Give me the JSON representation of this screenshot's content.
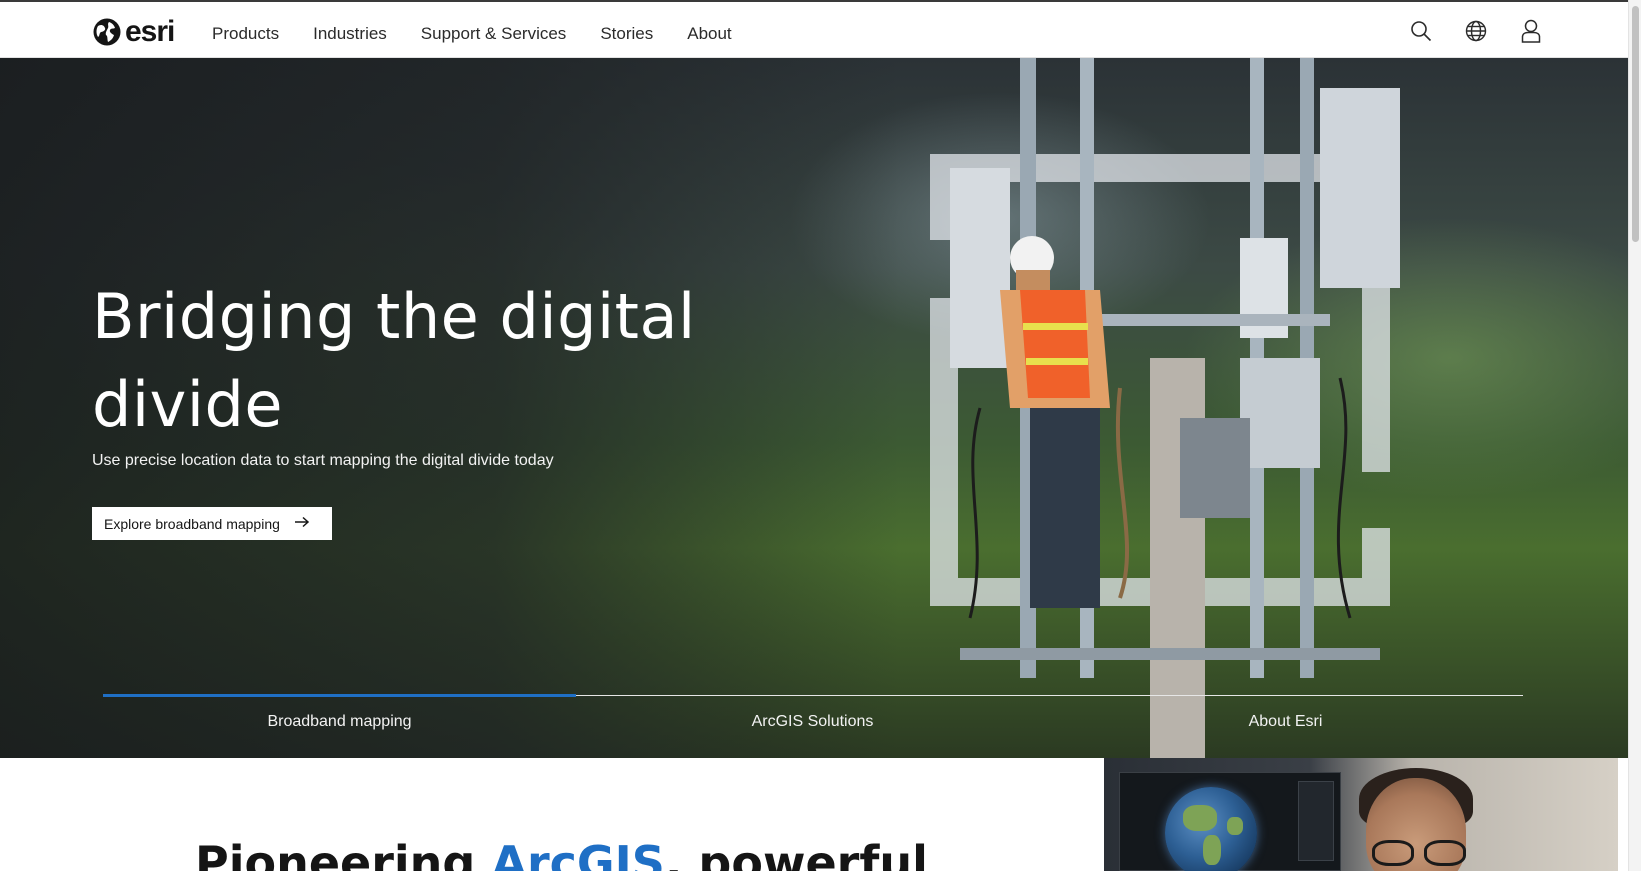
{
  "brand": {
    "name": "esri"
  },
  "nav": {
    "items": [
      {
        "label": "Products"
      },
      {
        "label": "Industries"
      },
      {
        "label": "Support & Services"
      },
      {
        "label": "Stories"
      },
      {
        "label": "About"
      }
    ],
    "icons": [
      "search-icon",
      "globe-icon",
      "user-icon"
    ]
  },
  "hero": {
    "title": "Bridging the digital divide",
    "subtitle": "Use precise location data to start mapping the digital divide today",
    "cta_label": "Explore broadband mapping",
    "cta_icon": "arrow-right-icon",
    "tabs": [
      {
        "label": "Broadband mapping",
        "active": true
      },
      {
        "label": "ArcGIS Solutions",
        "active": false
      },
      {
        "label": "About Esri",
        "active": false
      }
    ],
    "accent_color": "#1f6fc5"
  },
  "lower": {
    "heading_pre": "Pioneering ",
    "heading_accent": "ArcGIS",
    "heading_post": ", powerful"
  }
}
